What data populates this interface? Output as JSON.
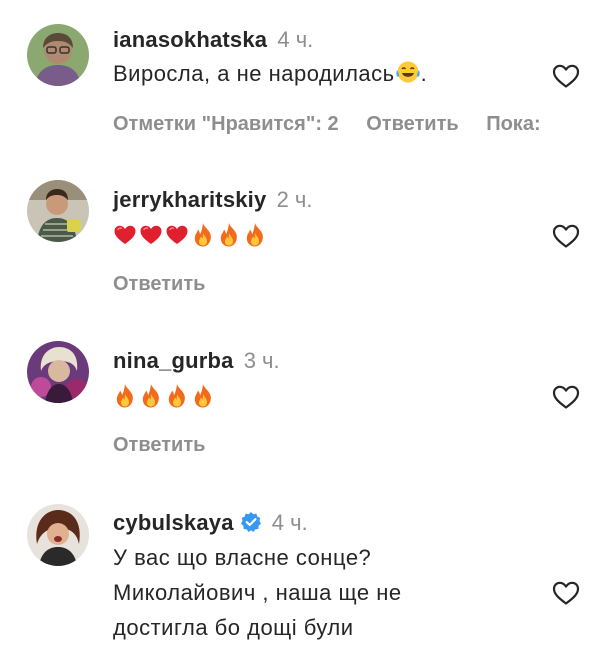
{
  "comments": [
    {
      "username": "ianasokhatska",
      "time": "4 ч.",
      "text": "Виросла, а не народилась",
      "text_suffix": ".",
      "inline_emoji": "tears-of-joy",
      "likes_label": "Отметки \"Нравится\": 2",
      "reply_label": "Ответить",
      "more_label": "Пока:",
      "avatar": "avatar-woman-glasses"
    },
    {
      "username": "jerrykharitskiy",
      "time": "2 ч.",
      "emojis": [
        "heart",
        "heart",
        "heart",
        "fire",
        "fire",
        "fire"
      ],
      "reply_label": "Ответить",
      "avatar": "avatar-man-striped-shirt"
    },
    {
      "username": "nina_gurba",
      "time": "3 ч.",
      "emojis": [
        "fire",
        "fire",
        "fire",
        "fire"
      ],
      "reply_label": "Ответить",
      "avatar": "avatar-woman-blonde"
    },
    {
      "username": "cybulskaya",
      "verified": true,
      "time": "4 ч.",
      "lines": [
        "У вас що власне сонце?",
        "Миколайович , наша ще не",
        "достигла бо дощі були"
      ],
      "avatar": "avatar-woman-brunette"
    }
  ],
  "colors": {
    "text": "#262626",
    "secondary": "#8e8e8e",
    "verified": "#3897f0",
    "heart_emoji": "#e0202f",
    "fire_outer": "#f26b1d",
    "fire_inner": "#ffc83d"
  }
}
